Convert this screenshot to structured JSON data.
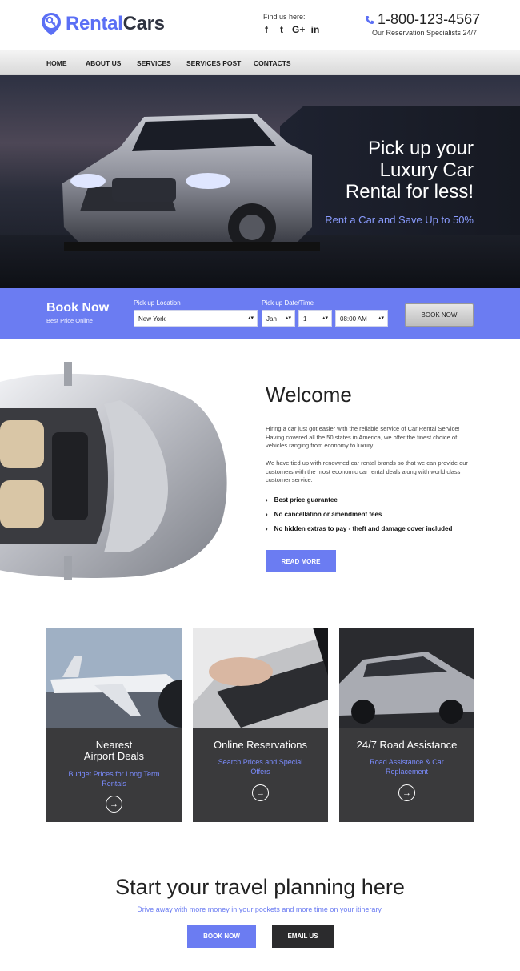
{
  "header": {
    "logo_part1": "Rental",
    "logo_part2": "Cars",
    "find_us": "Find us here:",
    "social": [
      "f",
      "t",
      "G+",
      "in"
    ],
    "phone": "1-800-123-4567",
    "phone_sub": "Our Reservation Specialists 24/7"
  },
  "nav": [
    "HOME",
    "ABOUT US",
    "SERVICES",
    "SERVICES POST",
    "CONTACTS"
  ],
  "hero": {
    "title_line1": "Pick up your",
    "title_line2": "Luxury Car",
    "title_line3": "Rental for less!",
    "subtitle": "Rent a Car and Save Up to 50%"
  },
  "booking": {
    "title": "Book Now",
    "subtitle": "Best Price Online",
    "location_label": "Pick up Location",
    "location_value": "New York",
    "date_label": "Pick up Date/Time",
    "month_value": "Jan",
    "day_value": "1",
    "time_value": "08:00 AM",
    "button": "BOOK NOW"
  },
  "welcome": {
    "title": "Welcome",
    "para1": "Hiring a car just got easier with the reliable service of Car Rental Service! Having covered all the 50 states in America, we offer the finest choice of vehicles ranging from economy to luxury.",
    "para2": "We have tied up with renowned car rental brands so that we can provide our customers with the most economic car rental deals along with world class customer service.",
    "bullets": [
      "Best price guarantee",
      "No cancellation or amendment fees",
      "No hidden extras to pay - theft and damage cover included"
    ],
    "button": "READ MORE"
  },
  "cards": [
    {
      "title_line1": "Nearest",
      "title_line2": "Airport Deals",
      "sub": "Budget Prices for Long Term Rentals"
    },
    {
      "title_line1": "Online Reservations",
      "title_line2": "",
      "sub": "Search Prices and Special Offers"
    },
    {
      "title_line1": "24/7 Road Assistance",
      "title_line2": "",
      "sub": "Road Assistance & Car Replacement"
    }
  ],
  "bottom": {
    "title": "Start your travel planning here",
    "subtitle": "Drive away with more money in your pockets and more time on your itinerary.",
    "book_button": "BOOK NOW",
    "email_button": "EMAIL US"
  },
  "colors": {
    "accent": "#6b7cf2",
    "dark": "#3a3a3c",
    "logo_blue": "#5b6ff5"
  },
  "icons": [
    "map-pin-key-icon",
    "facebook-icon",
    "twitter-icon",
    "google-plus-icon",
    "linkedin-icon",
    "phone-icon",
    "chevron-right-icon",
    "arrow-circle-icon"
  ]
}
